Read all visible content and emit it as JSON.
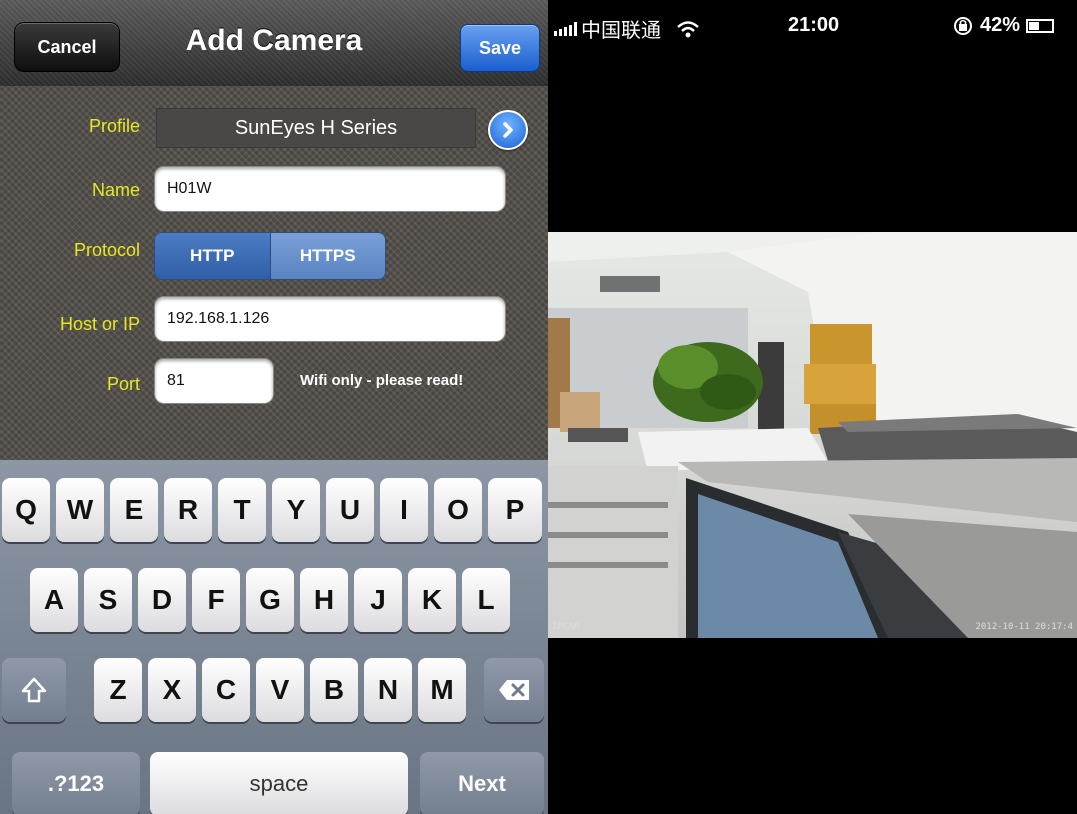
{
  "navbar": {
    "title": "Add Camera",
    "cancel_label": "Cancel",
    "save_label": "Save"
  },
  "form": {
    "profile": {
      "label": "Profile",
      "value": "SunEyes H Series"
    },
    "name": {
      "label": "Name",
      "value": "H01W"
    },
    "protocol": {
      "label": "Protocol",
      "options": [
        "HTTP",
        "HTTPS"
      ],
      "selected": "HTTP"
    },
    "host": {
      "label": "Host or IP",
      "value": "192.168.1.126"
    },
    "port": {
      "label": "Port",
      "value": "81",
      "note": "Wifi only - please read!"
    }
  },
  "keyboard": {
    "row1": [
      "Q",
      "W",
      "E",
      "R",
      "T",
      "Y",
      "U",
      "I",
      "O",
      "P"
    ],
    "row2": [
      "A",
      "S",
      "D",
      "F",
      "G",
      "H",
      "J",
      "K",
      "L"
    ],
    "row3": [
      "Z",
      "X",
      "C",
      "V",
      "B",
      "N",
      "M"
    ],
    "numbers_label": ".?123",
    "space_label": "space",
    "next_label": "Next"
  },
  "statusbar": {
    "carrier": "中国联通",
    "time": "21:00",
    "battery": "42%"
  },
  "camera_view": {
    "label": "IPCAM",
    "timestamp": "2012-10-11 20:17:4"
  },
  "colors": {
    "label_yellow": "#e8e822",
    "save_blue": "#1a5fcf",
    "segment_selected": "#305fa6"
  },
  "icons": {
    "profile_detail": "chevron-right-circle-icon",
    "shift": "shift-icon",
    "backspace": "backspace-icon",
    "wifi": "wifi-icon",
    "rotation_lock": "rotation-lock-icon",
    "battery": "battery-icon",
    "signal": "signal-bars-icon"
  }
}
